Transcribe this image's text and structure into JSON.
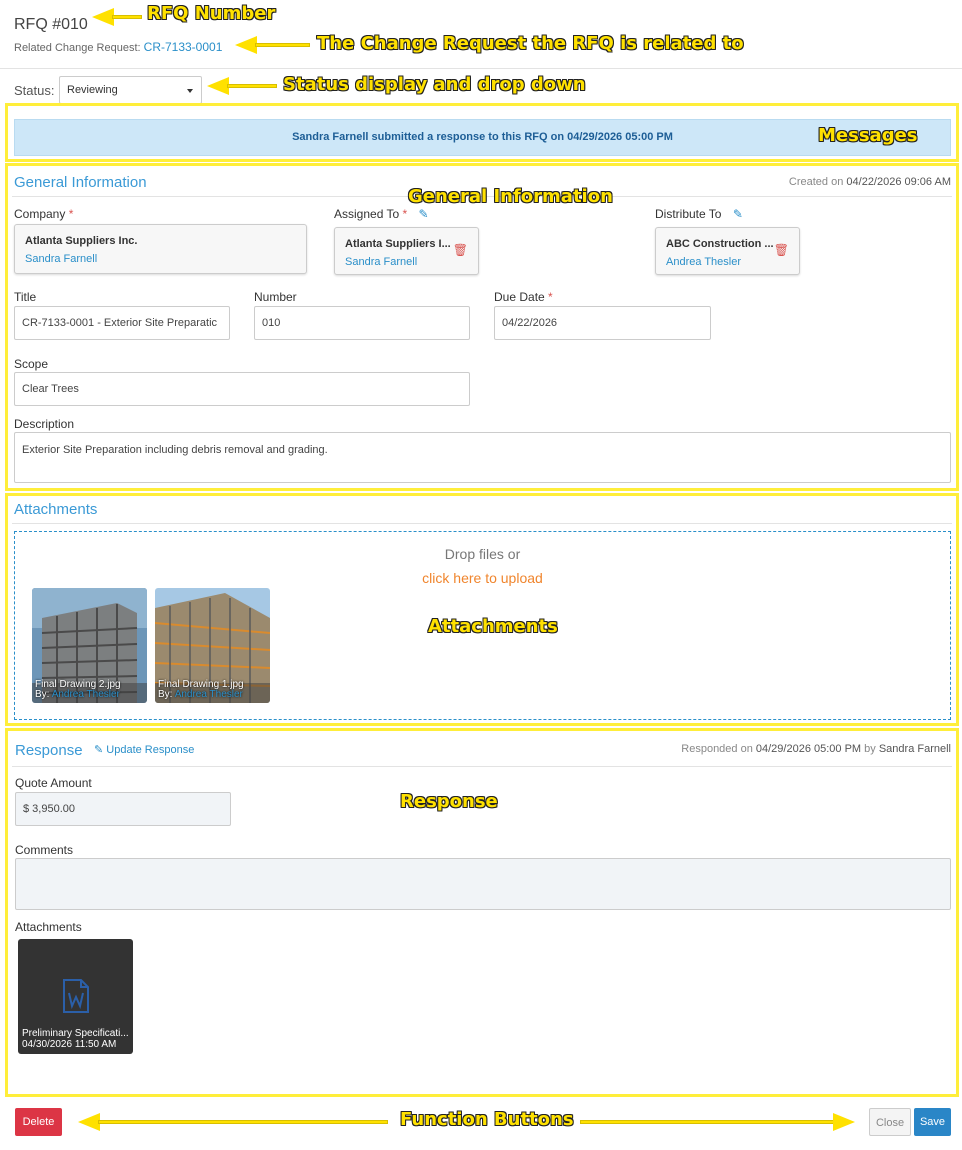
{
  "header": {
    "title": "RFQ #010",
    "related_label": "Related Change Request:",
    "related_link": "CR-7133-0001"
  },
  "status": {
    "label": "Status:",
    "value": "Reviewing"
  },
  "message": "Sandra Farnell submitted a response to this RFQ on 04/29/2026 05:00 PM",
  "general": {
    "title": "General Information",
    "created_prefix": "Created on",
    "created_date": "04/22/2026 09:06 AM",
    "company_label": "Company",
    "company_name": "Atlanta Suppliers Inc.",
    "company_person": "Sandra Farnell",
    "assigned_label": "Assigned To",
    "assigned_name": "Atlanta Suppliers I...",
    "assigned_person": "Sandra Farnell",
    "distribute_label": "Distribute To",
    "distribute_name": "ABC Construction ...",
    "distribute_person": "Andrea Thesler",
    "title_label": "Title",
    "title_value": "CR-7133-0001 - Exterior Site Preparatic",
    "number_label": "Number",
    "number_value": "010",
    "due_label": "Due Date",
    "due_value": "04/22/2026",
    "scope_label": "Scope",
    "scope_value": "Clear Trees",
    "description_label": "Description",
    "description_value": "Exterior Site Preparation including debris removal and grading."
  },
  "attachments": {
    "title": "Attachments",
    "drop_text": "Drop files or",
    "upload_link": "click here to upload",
    "files": [
      {
        "name": "Final Drawing 2.jpg",
        "by_label": "By:",
        "by": "Andrea Thesler"
      },
      {
        "name": "Final Drawing 1.jpg",
        "by_label": "By:",
        "by": "Andrea Thesler"
      }
    ]
  },
  "response": {
    "title": "Response",
    "update_link": "Update Response",
    "responded_prefix": "Responded on",
    "responded_date": "04/29/2026 05:00 PM",
    "responded_by_word": "by",
    "responded_by": "Sandra Farnell",
    "quote_label": "Quote Amount",
    "quote_value": "$ 3,950.00",
    "comments_label": "Comments",
    "comments_value": "",
    "attachments_label": "Attachments",
    "file_name": "Preliminary Specificati...",
    "file_date": "04/30/2026 11:50 AM",
    "file_icon": "word-document-icon"
  },
  "buttons": {
    "delete": "Delete",
    "close": "Close",
    "save": "Save"
  },
  "callouts": {
    "rfq_number": "RFQ Number",
    "change_request": "The Change Request the RFQ is related to",
    "status": "Status display and drop down",
    "messages": "Messages",
    "general": "General Information",
    "attachments": "Attachments",
    "response": "Response",
    "functions": "Function Buttons"
  },
  "colors": {
    "accent": "#2a8fc9",
    "highlight": "#ffee3a",
    "delete": "#dc3545",
    "save": "#2a86c7",
    "upload_link": "#f0852d"
  }
}
